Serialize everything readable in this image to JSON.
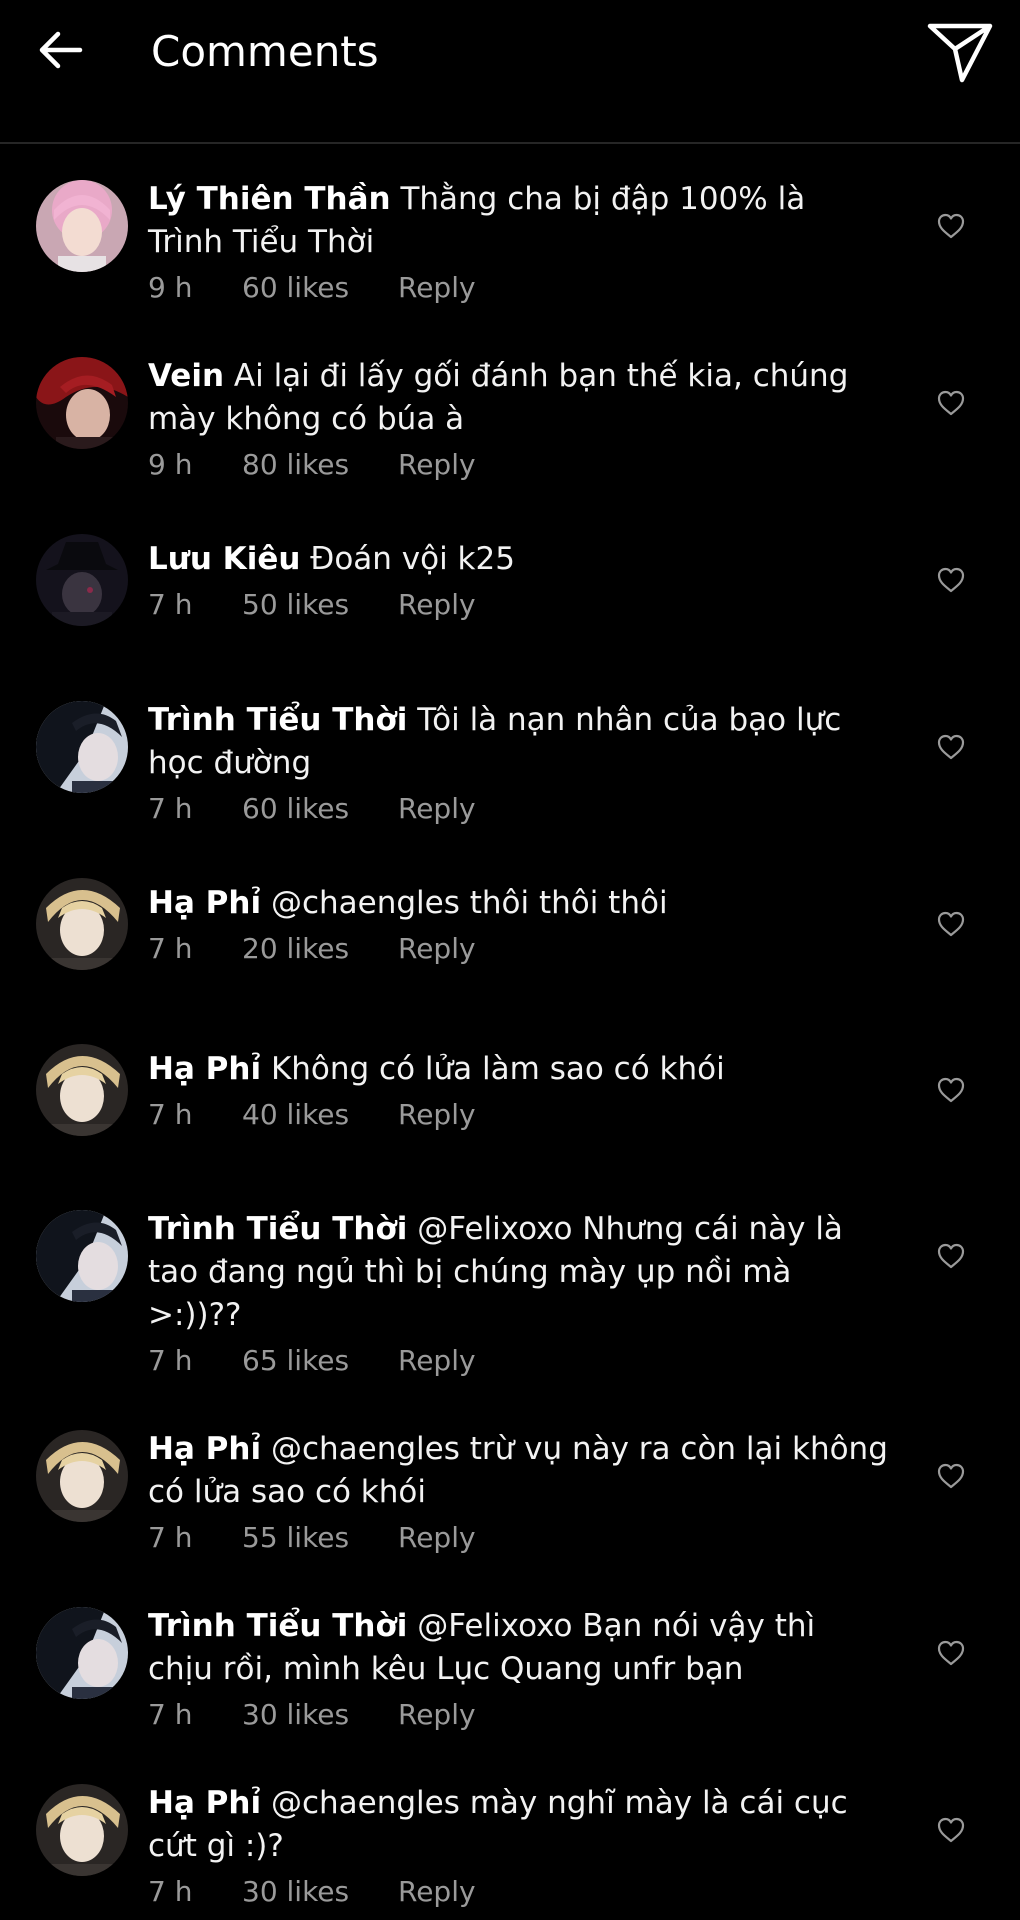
{
  "header": {
    "title": "Comments",
    "back_icon": "arrow-left-icon",
    "send_icon": "paper-plane-icon"
  },
  "colors": {
    "background": "#000000",
    "text": "#ffffff",
    "secondary_text": "#9a9a9a",
    "divider": "#262626"
  },
  "comments": [
    {
      "username": "Lý Thiên Thần",
      "text": "Thằng cha bị đập 100% là Trình Tiểu Thời",
      "time": "9 h",
      "likes": "60 likes",
      "reply": "Reply"
    },
    {
      "username": "Vein",
      "text": "Ai lại đi lấy gối đánh bạn thế kia, chúng mày không có búa à",
      "time": "9 h",
      "likes": "80 likes",
      "reply": "Reply"
    },
    {
      "username": "Lưu Kiêu",
      "text": "Đoán vội k25",
      "time": "7 h",
      "likes": "50 likes",
      "reply": "Reply"
    },
    {
      "username": "Trình Tiểu Thời",
      "text": "Tôi là nạn nhân của bạo lực học đường",
      "time": "7 h",
      "likes": "60 likes",
      "reply": "Reply"
    },
    {
      "username": "Hạ Phỉ",
      "text": "@chaengles thôi thôi thôi",
      "time": "7 h",
      "likes": "20 likes",
      "reply": "Reply"
    },
    {
      "username": "Hạ Phỉ",
      "text": "Không có lửa làm sao có khói",
      "time": "7 h",
      "likes": "40 likes",
      "reply": "Reply"
    },
    {
      "username": "Trình Tiểu Thời",
      "text": "@Felixoxo Nhưng cái này là tao đang ngủ thì bị chúng mày ụp nồi mà >:))??",
      "time": "7 h",
      "likes": "65 likes",
      "reply": "Reply"
    },
    {
      "username": "Hạ Phỉ",
      "text": "@chaengles trừ vụ này ra còn lại không có lửa sao có khói",
      "time": "7 h",
      "likes": "55 likes",
      "reply": "Reply"
    },
    {
      "username": "Trình Tiểu Thời",
      "text": "@Felixoxo Bạn nói vậy thì chịu rồi, mình kêu Lục Quang unfr bạn",
      "time": "7 h",
      "likes": "30 likes",
      "reply": "Reply"
    },
    {
      "username": "Hạ Phỉ",
      "text": "@chaengles mày nghĩ mày là cái cục cứt gì :)?",
      "time": "7 h",
      "likes": "30 likes",
      "reply": "Reply"
    }
  ]
}
